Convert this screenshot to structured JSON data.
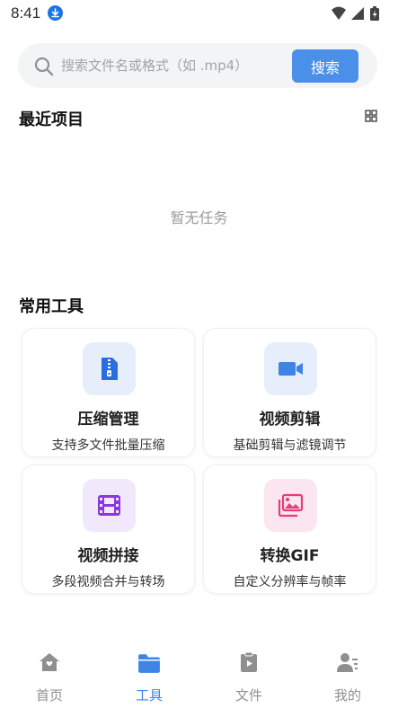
{
  "status_bar": {
    "time": "8:41"
  },
  "search": {
    "placeholder": "搜索文件名或格式（如 .mp4）",
    "button_label": "搜索"
  },
  "recent": {
    "title": "最近项目",
    "empty_text": "暂无任务"
  },
  "tools": {
    "title": "常用工具",
    "items": [
      {
        "name": "压缩管理",
        "desc": "支持多文件批量压缩",
        "icon": "zip-file-icon",
        "color": "#2b6de0"
      },
      {
        "name": "视频剪辑",
        "desc": "基础剪辑与滤镜调节",
        "icon": "video-camera-icon",
        "color": "#3d84e6"
      },
      {
        "name": "视频拼接",
        "desc": "多段视频合并与转场",
        "icon": "film-icon",
        "color": "#8a37e0"
      },
      {
        "name": "转换GIF",
        "desc": "自定义分辨率与帧率",
        "icon": "photo-stack-icon",
        "color": "#e63c79"
      }
    ]
  },
  "nav": {
    "items": [
      {
        "label": "首页",
        "icon": "home-icon"
      },
      {
        "label": "工具",
        "icon": "folder-icon",
        "active": true
      },
      {
        "label": "文件",
        "icon": "clipboard-play-icon"
      },
      {
        "label": "我的",
        "icon": "user-list-icon"
      }
    ]
  },
  "colors": {
    "accent": "#4a8fe8",
    "inactive": "#8f8f8f",
    "search_bg": "#f3f4f6"
  }
}
